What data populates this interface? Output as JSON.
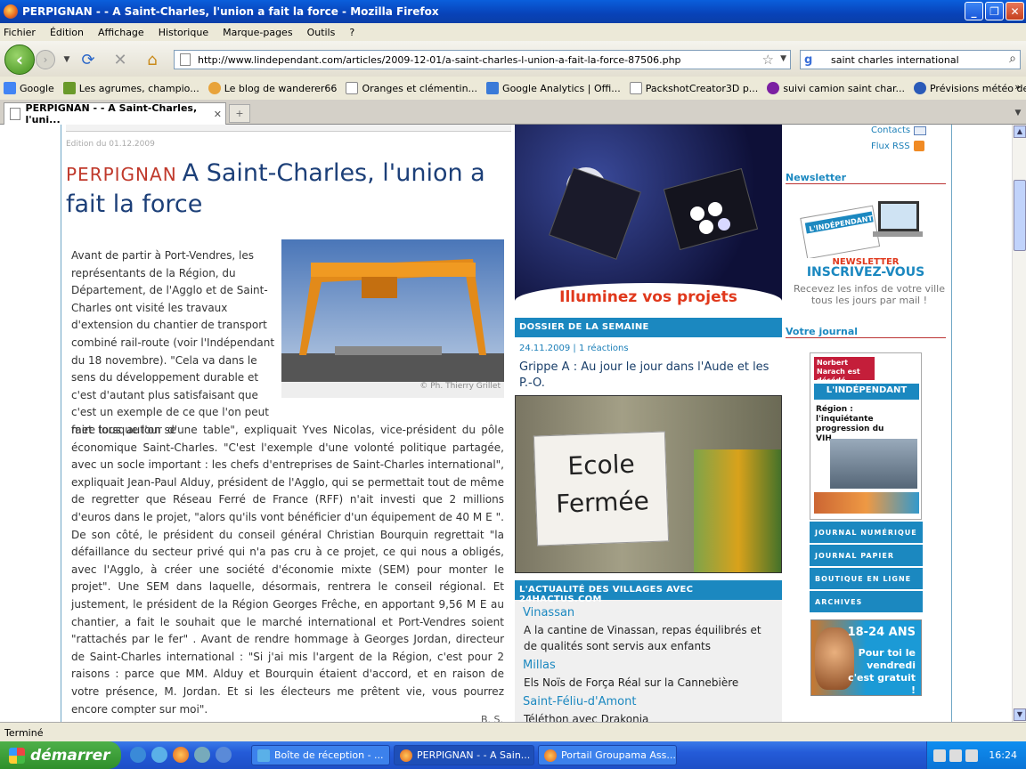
{
  "window": {
    "title": "PERPIGNAN - - A Saint-Charles, l'union a fait la force - Mozilla Firefox",
    "controls": [
      "_",
      "❐",
      "✕"
    ]
  },
  "menu": [
    "Fichier",
    "Édition",
    "Affichage",
    "Historique",
    "Marque-pages",
    "Outils",
    "?"
  ],
  "nav": {
    "url": "http://www.lindependant.com/articles/2009-12-01/a-saint-charles-l-union-a-fait-la-force-87506.php",
    "search_value": "saint charles international"
  },
  "bookmarks": [
    {
      "label": "Google",
      "color": "#4285f4"
    },
    {
      "label": "Les agrumes, champio...",
      "color": "#6a9a2a"
    },
    {
      "label": "Le blog de wanderer66",
      "color": "#e8a33a"
    },
    {
      "label": "Oranges et clémentin...",
      "color": "#ffffff"
    },
    {
      "label": "Google Analytics | Offi...",
      "color": "#3a7ad8"
    },
    {
      "label": "PackshotCreator3D p...",
      "color": "#ffffff"
    },
    {
      "label": "suivi camion saint char...",
      "color": "#7b1fa2"
    },
    {
      "label": "Prévisions météo de M...",
      "color": "#2a5ab8"
    }
  ],
  "tab": {
    "label": "PERPIGNAN - - A Saint-Charles, l'uni..."
  },
  "article": {
    "edition": "Edition du 01.12.2009",
    "rubric": "PERPIGNAN",
    "headline": "A Saint-Charles, l'union a fait la force",
    "photo_credit": "© Ph. Thierry Grillet",
    "p1": "Avant de partir à Port-Vendres, les représentants de la Région, du Département, de l'Agglo et de Saint-Charles ont visité les travaux d'extension du chantier de transport combiné rail-route (voir l'Indépendant du 18 novembre). \"Cela va dans le sens du développement durable et c'est d'autant plus satisfaisant que c'est un exemple de ce que l'on peut faire lorsque l'on se",
    "p2": "met tous autour d'une table\", expliquait Yves Nicolas, vice-président du pôle économique Saint-Charles. \"C'est l'exemple d'une volonté politique partagée, avec un socle important : les chefs d'entreprises de Saint-Charles international\", expliquait Jean-Paul Alduy, président de l'Agglo, qui se permettait tout de même de regretter que Réseau Ferré de France (RFF) n'ait investi que 2 millions d'euros dans le projet, \"alors qu'ils vont bénéficier d'un équipement de 40 M E \". De son côté, le président du conseil général Christian Bourquin regrettait \"la défaillance du secteur privé qui n'a pas cru à ce projet, ce qui nous a obligés, avec l'Agglo, à créer une société d'économie mixte (SEM) pour monter le projet\". Une SEM dans laquelle, désormais, rentrera le conseil régional. Et justement, le président de la Région Georges Frêche, en apportant 9,56 M E au chantier, a fait le souhait que le marché international et Port-Vendres soient \"rattachés par le fer\" . Avant de rendre hommage à Georges Jordan, directeur de Saint-Charles international : \"Si j'ai mis l'argent de la Région, c'est pour 2 raisons : parce que MM. Alduy et Bourquin étaient d'accord, et en raison de votre présence, M. Jordan. Et si les électeurs me prêtent vie, vous pourrez encore compter sur moi\".",
    "signature": "B. S."
  },
  "middle": {
    "banner_text": "Illuminez vos projets",
    "dossier_header": "DOSSIER DE LA SEMAINE",
    "dossier_meta": "24.11.2009 | 1 réactions",
    "dossier_title": "Grippe A : Au jour le jour dans l'Aude et les P.-O.",
    "sign_line1": "Ecole",
    "sign_line2": "Fermée",
    "villages_header": "L'ACTUALITÉ DES VILLAGES AVEC 24HACTUS.COM",
    "villages": [
      {
        "name": "Vinassan",
        "text": "A la cantine de Vinassan, repas équilibrés et de qualités sont servis aux enfants"
      },
      {
        "name": "Millas",
        "text": "Els Noïs de Força Réal sur la Cannebière"
      },
      {
        "name": "Saint-Féliu-d'Amont",
        "text": "Téléthon avec Drakonia"
      }
    ]
  },
  "right": {
    "contacts": "Contacts",
    "rss": "Flux RSS",
    "newsletter_header": "Newsletter",
    "newsletter_brand": "L'INDÉPENDANT",
    "newsletter_label": "NEWSLETTER",
    "newsletter_cta": "INSCRIVEZ-VOUS",
    "newsletter_desc": "Recevez les infos de votre ville tous les jours par mail !",
    "journal_header": "Votre journal",
    "journal_headline1": "Norbert Narach est décédé",
    "journal_brand": "L'INDÉPENDANT",
    "journal_headline2": "Région : l'inquiétante progression du VIH",
    "journal_links": [
      "JOURNAL NUMÉRIQUE",
      "JOURNAL PAPIER",
      "BOUTIQUE EN LIGNE",
      "ARCHIVES"
    ],
    "promo_title": "18-24 ANS",
    "promo_text": "Pour toi le vendredi c'est gratuit !"
  },
  "status": "Terminé",
  "taskbar": {
    "start": "démarrer",
    "tasks": [
      "Boîte de réception - ...",
      "PERPIGNAN - - A Sain...",
      "Portail Groupama Ass..."
    ],
    "clock": "16:24"
  }
}
